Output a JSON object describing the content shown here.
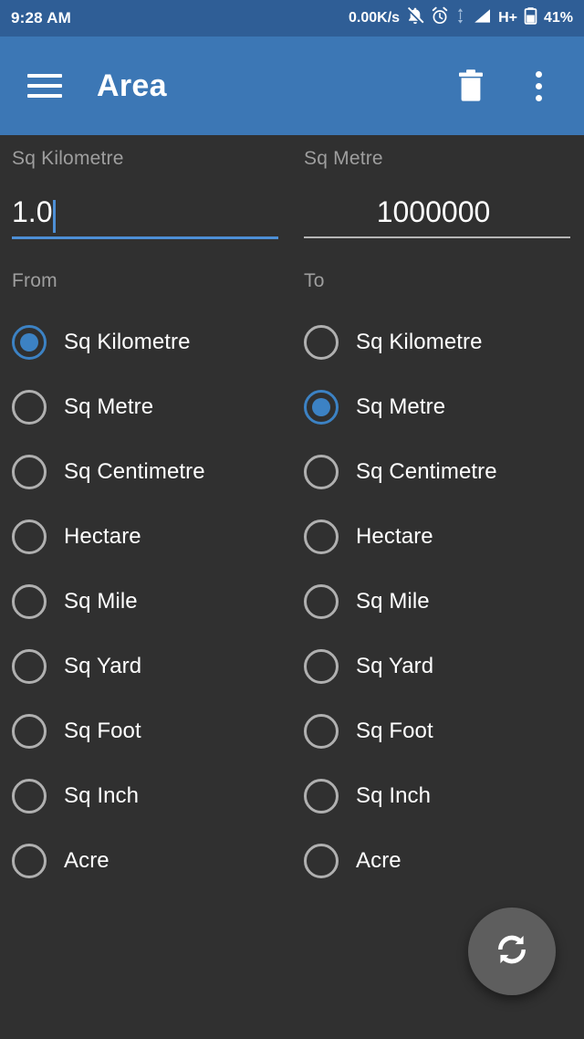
{
  "status_bar": {
    "time": "9:28 AM",
    "net_speed": "0.00K/s",
    "network_type": "H+",
    "battery_percent": "41%",
    "icons": [
      "bell-muted-icon",
      "alarm-icon",
      "data-transfer-icon",
      "signal-icon",
      "battery-icon"
    ],
    "background_color": "#2F5E96"
  },
  "app_bar": {
    "title": "Area",
    "menu_icon": "hamburger-menu-icon",
    "delete_icon": "trash-icon",
    "overflow_icon": "overflow-menu-icon",
    "background_color": "#3C77B5"
  },
  "from_field": {
    "label": "Sq Kilometre",
    "value": "1.0",
    "placeholder": "",
    "focused": true,
    "accent_color": "#4D8FD6"
  },
  "to_field": {
    "label": "Sq Metre",
    "value": "1000000",
    "placeholder": "",
    "focused": false,
    "line_color": "#B5B5B5"
  },
  "from_group": {
    "label": "From",
    "selected": "Sq Kilometre",
    "options": [
      {
        "label": "Sq Kilometre",
        "selected": true
      },
      {
        "label": "Sq Metre",
        "selected": false
      },
      {
        "label": "Sq Centimetre",
        "selected": false
      },
      {
        "label": "Hectare",
        "selected": false
      },
      {
        "label": "Sq Mile",
        "selected": false
      },
      {
        "label": "Sq Yard",
        "selected": false
      },
      {
        "label": "Sq Foot",
        "selected": false
      },
      {
        "label": "Sq Inch",
        "selected": false
      },
      {
        "label": "Acre",
        "selected": false
      }
    ]
  },
  "to_group": {
    "label": "To",
    "selected": "Sq Metre",
    "options": [
      {
        "label": "Sq Kilometre",
        "selected": false
      },
      {
        "label": "Sq Metre",
        "selected": true
      },
      {
        "label": "Sq Centimetre",
        "selected": false
      },
      {
        "label": "Hectare",
        "selected": false
      },
      {
        "label": "Sq Mile",
        "selected": false
      },
      {
        "label": "Sq Yard",
        "selected": false
      },
      {
        "label": "Sq Foot",
        "selected": false
      },
      {
        "label": "Sq Inch",
        "selected": false
      },
      {
        "label": "Acre",
        "selected": false
      }
    ]
  },
  "fab": {
    "icon": "swap-icon",
    "background_color": "#5E5E5E"
  },
  "theme": {
    "background": "#303030",
    "accent": "#3C82C4",
    "label_text": "#9E9E9E",
    "primary_text": "#FFFFFF"
  }
}
